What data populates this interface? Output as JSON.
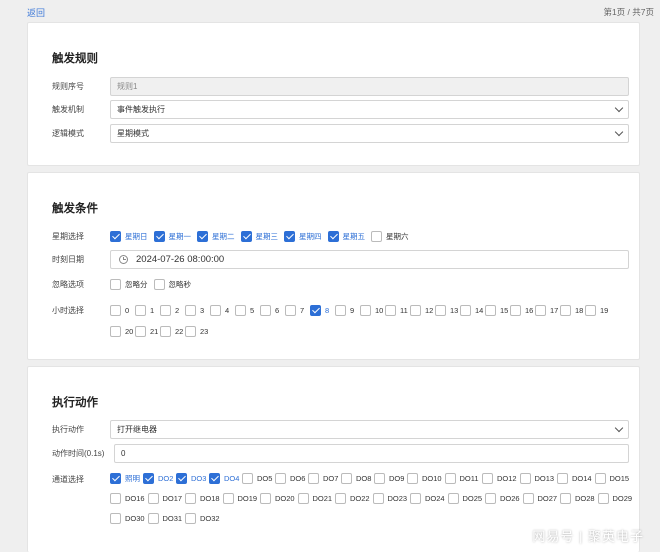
{
  "topbar": {
    "back": "返回",
    "page": "第1页 / 共7页"
  },
  "rules": {
    "title": "触发规则",
    "id_label": "规则序号",
    "id_value": "规则1",
    "mechanism_label": "触发机制",
    "mechanism_value": "事件触发执行",
    "logic_label": "逻辑模式",
    "logic_value": "星期模式"
  },
  "conditions": {
    "title": "触发条件",
    "week_label": "星期选择",
    "weekdays": [
      {
        "label": "星期日",
        "checked": true
      },
      {
        "label": "星期一",
        "checked": true
      },
      {
        "label": "星期二",
        "checked": true
      },
      {
        "label": "星期三",
        "checked": true
      },
      {
        "label": "星期四",
        "checked": true
      },
      {
        "label": "星期五",
        "checked": true
      },
      {
        "label": "星期六",
        "checked": false
      }
    ],
    "datetime_label": "时刻日期",
    "datetime_value": "2024-07-26 08:00:00",
    "ignore_label": "忽略选项",
    "ignore_options": [
      {
        "label": "忽略分",
        "checked": false
      },
      {
        "label": "忽略秒",
        "checked": false
      }
    ],
    "hour_label": "小时选择",
    "hours": [
      {
        "label": "0",
        "checked": false
      },
      {
        "label": "1",
        "checked": false
      },
      {
        "label": "2",
        "checked": false
      },
      {
        "label": "3",
        "checked": false
      },
      {
        "label": "4",
        "checked": false
      },
      {
        "label": "5",
        "checked": false
      },
      {
        "label": "6",
        "checked": false
      },
      {
        "label": "7",
        "checked": false
      },
      {
        "label": "8",
        "checked": true
      },
      {
        "label": "9",
        "checked": false
      },
      {
        "label": "10",
        "checked": false
      },
      {
        "label": "11",
        "checked": false
      },
      {
        "label": "12",
        "checked": false
      },
      {
        "label": "13",
        "checked": false
      },
      {
        "label": "14",
        "checked": false
      },
      {
        "label": "15",
        "checked": false
      },
      {
        "label": "16",
        "checked": false
      },
      {
        "label": "17",
        "checked": false
      },
      {
        "label": "18",
        "checked": false
      },
      {
        "label": "19",
        "checked": false
      },
      {
        "label": "20",
        "checked": false
      },
      {
        "label": "21",
        "checked": false
      },
      {
        "label": "22",
        "checked": false
      },
      {
        "label": "23",
        "checked": false
      }
    ]
  },
  "actions": {
    "title": "执行动作",
    "action_label": "执行动作",
    "action_value": "打开继电器",
    "time_label": "动作时间(0.1s)",
    "time_value": "0",
    "channel_label": "通道选择",
    "channels": [
      {
        "label": "照明",
        "checked": true
      },
      {
        "label": "DO2",
        "checked": true
      },
      {
        "label": "DO3",
        "checked": true
      },
      {
        "label": "DO4",
        "checked": true
      },
      {
        "label": "DO5",
        "checked": false
      },
      {
        "label": "DO6",
        "checked": false
      },
      {
        "label": "DO7",
        "checked": false
      },
      {
        "label": "DO8",
        "checked": false
      },
      {
        "label": "DO9",
        "checked": false
      },
      {
        "label": "DO10",
        "checked": false
      },
      {
        "label": "DO11",
        "checked": false
      },
      {
        "label": "DO12",
        "checked": false
      },
      {
        "label": "DO13",
        "checked": false
      },
      {
        "label": "DO14",
        "checked": false
      },
      {
        "label": "DO15",
        "checked": false
      },
      {
        "label": "DO16",
        "checked": false
      },
      {
        "label": "DO17",
        "checked": false
      },
      {
        "label": "DO18",
        "checked": false
      },
      {
        "label": "DO19",
        "checked": false
      },
      {
        "label": "DO20",
        "checked": false
      },
      {
        "label": "DO21",
        "checked": false
      },
      {
        "label": "DO22",
        "checked": false
      },
      {
        "label": "DO23",
        "checked": false
      },
      {
        "label": "DO24",
        "checked": false
      },
      {
        "label": "DO25",
        "checked": false
      },
      {
        "label": "DO26",
        "checked": false
      },
      {
        "label": "DO27",
        "checked": false
      },
      {
        "label": "DO28",
        "checked": false
      },
      {
        "label": "DO29",
        "checked": false
      },
      {
        "label": "DO30",
        "checked": false
      },
      {
        "label": "DO31",
        "checked": false
      },
      {
        "label": "DO32",
        "checked": false
      }
    ]
  },
  "watermark": "网易号 | 聚英电子",
  "colors": {
    "accent": "#2d6fd6",
    "link": "#3c78d8",
    "background": "#efefef"
  }
}
